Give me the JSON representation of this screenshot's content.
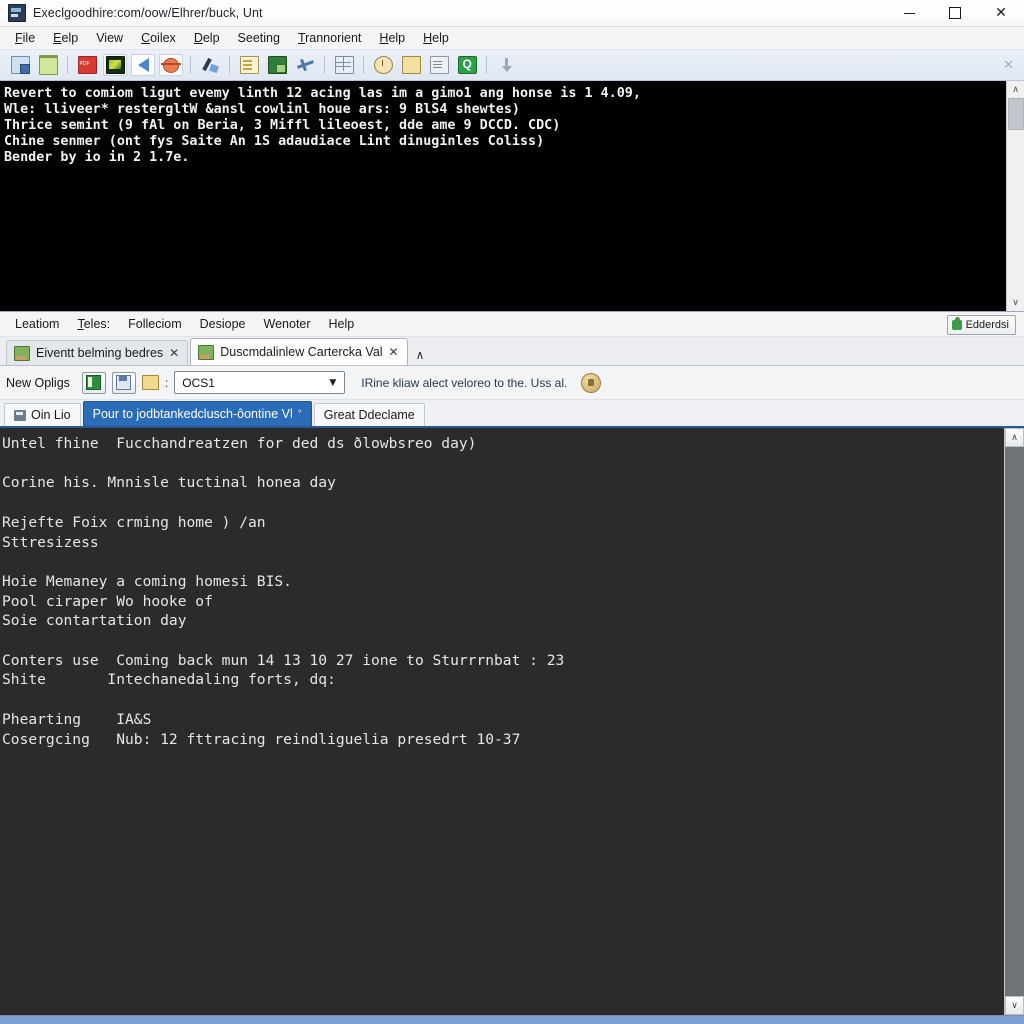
{
  "window": {
    "title": "Execlgoodhire:com/oow/Elhrer/buck, Unt",
    "icon": "app-window-icon",
    "controls": {
      "minimize": "—",
      "maximize": "□",
      "close": "✕"
    }
  },
  "menubar": {
    "items": [
      {
        "label": "File",
        "mnemonic": "F"
      },
      {
        "label": "Eelp",
        "mnemonic": "E"
      },
      {
        "label": "View",
        "mnemonic": ""
      },
      {
        "label": "Coilex",
        "mnemonic": "C"
      },
      {
        "label": "Delp",
        "mnemonic": "D"
      },
      {
        "label": "Seeting",
        "mnemonic": "S"
      },
      {
        "label": "Trannorient",
        "mnemonic": "T"
      },
      {
        "label": "Help",
        "mnemonic": "H"
      },
      {
        "label": "Help",
        "mnemonic": "H"
      }
    ]
  },
  "toolbar": {
    "buttons": [
      {
        "name": "open-documents-icon",
        "style": "ico-docs",
        "selected": false
      },
      {
        "name": "folder-icon",
        "style": "ico-folder",
        "selected": false
      },
      {
        "name": "pdf-export-icon",
        "style": "ico-red",
        "selected": false
      },
      {
        "name": "image-preview-icon",
        "style": "ico-dark",
        "selected": true
      },
      {
        "name": "back-arrow-icon",
        "style": "ico-arrow-l",
        "selected": true
      },
      {
        "name": "debug-bug-icon",
        "style": "ico-bug",
        "selected": true
      },
      {
        "name": "wrench-tools-icon",
        "style": "ico-wrench",
        "selected": false
      },
      {
        "name": "page-properties-icon",
        "style": "ico-page",
        "selected": false
      },
      {
        "name": "deploy-box-icon",
        "style": "ico-green-box",
        "selected": false
      },
      {
        "name": "disconnect-plane-icon",
        "style": "ico-plane",
        "selected": false
      },
      {
        "name": "table-grid-icon",
        "style": "ico-grid",
        "selected": false
      },
      {
        "name": "history-clock-icon",
        "style": "ico-clock",
        "selected": false
      },
      {
        "name": "note-icon",
        "style": "ico-note",
        "selected": false
      },
      {
        "name": "report-icon",
        "style": "ico-note2",
        "selected": false
      },
      {
        "name": "quick-query-icon",
        "style": "ico-qgreen",
        "selected": false
      },
      {
        "name": "download-arrow-icon",
        "style": "ico-down",
        "selected": false
      }
    ],
    "overflow_glyph": "✕"
  },
  "console": {
    "lines": [
      "Revert to comiom ligut evemy linth 12 acing las im a gimo1 ang honse is 1 4.09,",
      "Wle: lliveer* restergltW &ansl cowlinl houe ars: 9 BlS4 shewtes)",
      "Thrice semint (9 fAl on Beria, 3 Miffl lileoest, dde ame 9 DCCD. CDC)",
      "Chine senmer (ont fys Saite An 1S adaudiace Lint dinuginles Coliss)",
      "Bender by io in 2 1.7e."
    ],
    "scrollbar": {
      "up": "∧",
      "down": "∨"
    }
  },
  "menubar2": {
    "items": [
      {
        "label": "Leatiom",
        "mnemonic": ""
      },
      {
        "label": "Teles:",
        "mnemonic": "T"
      },
      {
        "label": "Folleciom",
        "mnemonic": ""
      },
      {
        "label": "Desiope",
        "mnemonic": ""
      },
      {
        "label": "Wenoter",
        "mnemonic": ""
      },
      {
        "label": "Help",
        "mnemonic": ""
      }
    ],
    "extension_button": "Edderdsi"
  },
  "file_tabs": {
    "tabs": [
      {
        "label": "Eiventt belming bedres",
        "active": false,
        "close": "✕"
      },
      {
        "label": "Duscmdalinlew Cartercka Val",
        "active": true,
        "close": "✕"
      }
    ],
    "chevron": "∧"
  },
  "options_bar": {
    "label": "New Opligs",
    "buttons": [
      {
        "name": "library-book-icon",
        "style": "ico-book"
      },
      {
        "name": "save-disk-icon",
        "style": "ico-disk"
      }
    ],
    "folder_icon": "folder-small-icon",
    "separator": ":",
    "combo_value": "OCS1",
    "combo_arrow": "▼",
    "hint": "IRine kliaw alect veloreo to the. Uss al.",
    "lock_badge": "lock-badge-icon"
  },
  "sub_tabs": {
    "tabs": [
      {
        "label": "Oin Lio",
        "active": false,
        "mark": ""
      },
      {
        "label": "Pour to jodbtankedclusch-ôontine Vl",
        "active": true,
        "mark": "°"
      },
      {
        "label": "Great Ddeclame",
        "active": false,
        "mark": ""
      }
    ]
  },
  "editor": {
    "lines": [
      "Untel fhine  Fucchandreatzen for ded ds ðlowbsreo day)",
      "",
      "Corine his. Mnnisle tuctinal honea day",
      "",
      "Rejefte Foix crming home ) /an",
      "Sttresizess",
      "",
      "Hoie Memaney a coming homesi BIS.",
      "Pool ciraper Wo hooke of",
      "Soie contartation day",
      "",
      "Conters use  Coming back mun 14 13 10 27 ione to Sturrrnbat : 23",
      "Shite       Intechanedaling forts, dq:",
      "",
      "Phearting    IA&S",
      "Cosergcing   Nub: 12 fttracing reindliguelia presedrt 10-37"
    ],
    "scrollbar": {
      "up": "∧",
      "down": "∨"
    }
  },
  "colors": {
    "console_bg": "#000000",
    "editor_bg": "#2b2b2b",
    "active_tab": "#2b6cb8",
    "accent_underline": "#2b5797",
    "bottom_strip": "#7b9fd0",
    "toolbar_top": "#ecf1f8"
  }
}
